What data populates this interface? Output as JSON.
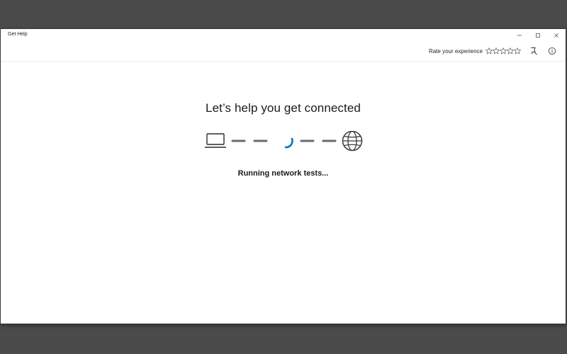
{
  "window": {
    "title": "Get Help",
    "controls": {
      "minimize": "—",
      "maximize": "☐",
      "close": "✕"
    }
  },
  "toolbar": {
    "rate_label": "Rate your experience",
    "star_count": 5,
    "icons": [
      "feedback-icon",
      "info-icon"
    ]
  },
  "main": {
    "heading": "Let’s help you get connected",
    "status": "Running network tests...",
    "progress_icons": {
      "left": "laptop-icon",
      "middle": "loading-spinner",
      "right": "globe-icon"
    },
    "accent_color": "#0a72b8"
  }
}
